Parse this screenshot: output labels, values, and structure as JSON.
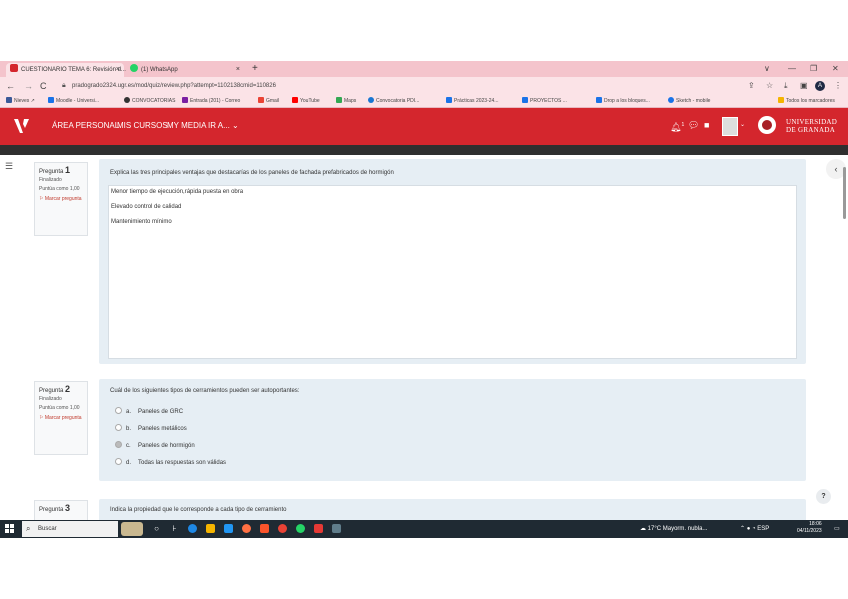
{
  "browser": {
    "tabs": [
      {
        "label": "CUESTIONARIO TEMA 6: Revisión d...",
        "close": "×"
      },
      {
        "label": "(1) WhatsApp",
        "close": "×"
      }
    ],
    "new_tab": "+",
    "window_controls": {
      "chevron": "∨",
      "minimize": "—",
      "maximize": "❐",
      "close": "✕"
    },
    "url": "pradogrado2324.ugr.es/mod/quiz/review.php?attempt=1102138cmid=110826",
    "profile_initial": "A"
  },
  "bookmarks": [
    {
      "label": "Nieves ↗",
      "color": "#3b5998"
    },
    {
      "label": "Moodle - Universi...",
      "color": "#1a73e8"
    },
    {
      "label": "CONVOCATORIAS",
      "color": "#333333"
    },
    {
      "label": "Entrada (201) - Correo",
      "color": "#7b1fa2"
    },
    {
      "label": "Gmail",
      "color": "#ea4335"
    },
    {
      "label": "YouTube",
      "color": "#ff0000"
    },
    {
      "label": "Maps",
      "color": "#34a853"
    },
    {
      "label": "Convocatoria PDI...",
      "color": "#1976d2"
    },
    {
      "label": "Prácticas 2023-24...",
      "color": "#1a73e8"
    },
    {
      "label": "PROYECTOS ...",
      "color": "#1a73e8"
    },
    {
      "label": "Drop a los bloques...",
      "color": "#1a73e8"
    },
    {
      "label": "Sketch - mobile",
      "color": "#1a73e8"
    },
    {
      "label": "Todos los marcadores",
      "color": "#f4b400"
    }
  ],
  "moodle_nav": {
    "links": [
      "ÁREA PERSONAL",
      "MIS CURSOS",
      "MY MEDIA",
      "IR A... ⌄"
    ],
    "notification_count": "1",
    "university": [
      "UNIVERSIDAD",
      "DE GRANADA"
    ]
  },
  "questions": [
    {
      "label": "Pregunta",
      "number": "1",
      "status": "Finalizado",
      "points": "Puntúa como 1,00",
      "flag": "Marcar pregunta",
      "text": "Explica las tres principales ventajas que destacarías de los paneles de fachada prefabricados de hormigón",
      "answer_lines": [
        "Menor tiempo de ejecución,rápida puesta en obra",
        "Elevado control de calidad",
        "Mantenimiento mínimo"
      ]
    },
    {
      "label": "Pregunta",
      "number": "2",
      "status": "Finalizado",
      "points": "Puntúa como 1,00",
      "flag": "Marcar pregunta",
      "text": "Cuál de los siguientes tipos de cerramientos pueden ser autoportantes:",
      "options": [
        {
          "letter": "a.",
          "text": "Paneles de GRC",
          "selected": false
        },
        {
          "letter": "b.",
          "text": "Paneles metálicos",
          "selected": false
        },
        {
          "letter": "c.",
          "text": "Paneles de hormigón",
          "selected": true
        },
        {
          "letter": "d.",
          "text": "Todas las respuestas son válidas",
          "selected": false
        }
      ]
    },
    {
      "label": "Pregunta",
      "number": "3",
      "text": "Indica la propiedad que le corresponde a cada tipo de cerramiento"
    }
  ],
  "help_button": "?",
  "taskbar": {
    "search_placeholder": "Buscar",
    "weather": "17°C Mayorm. nubla...",
    "tray": "⌃  ● ◔  ESP",
    "time": "18:06",
    "date": "04/11/2023"
  }
}
